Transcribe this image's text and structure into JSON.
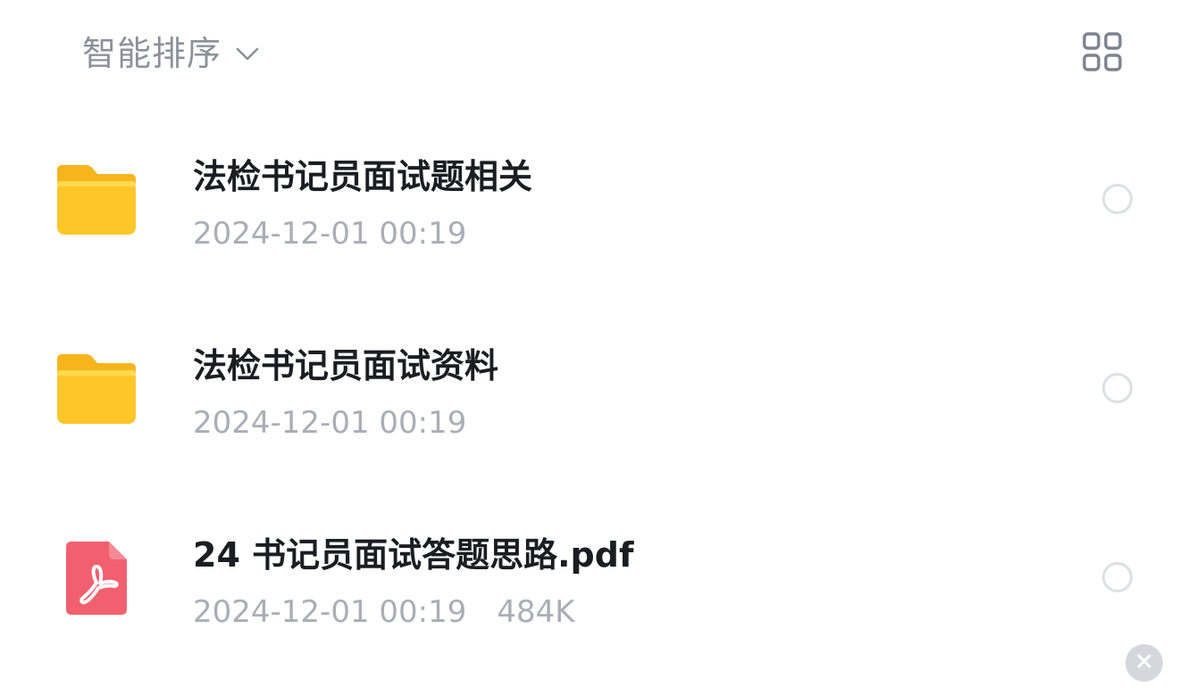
{
  "toolbar": {
    "sort_label": "智能排序",
    "sort_icon": "chevron-down-icon",
    "view_icon": "grid-view-icon"
  },
  "files": [
    {
      "name": "法检书记员面试题相关",
      "type": "folder",
      "icon": "folder-icon",
      "date": "2024-12-01 00:19",
      "size": ""
    },
    {
      "name": "法检书记员面试资料",
      "type": "folder",
      "icon": "folder-icon",
      "date": "2024-12-01 00:19",
      "size": ""
    },
    {
      "name": "24 书记员面试答题思路.pdf",
      "type": "pdf",
      "icon": "pdf-file-icon",
      "date": "2024-12-01 00:19",
      "size": "484K"
    }
  ],
  "colors": {
    "folder": "#ffc629",
    "pdf": "#f2606f",
    "title_text": "#1b1d22",
    "meta_text": "#a9aeb6",
    "toolbar_text": "#8b919b"
  },
  "close_icon": "close-icon"
}
